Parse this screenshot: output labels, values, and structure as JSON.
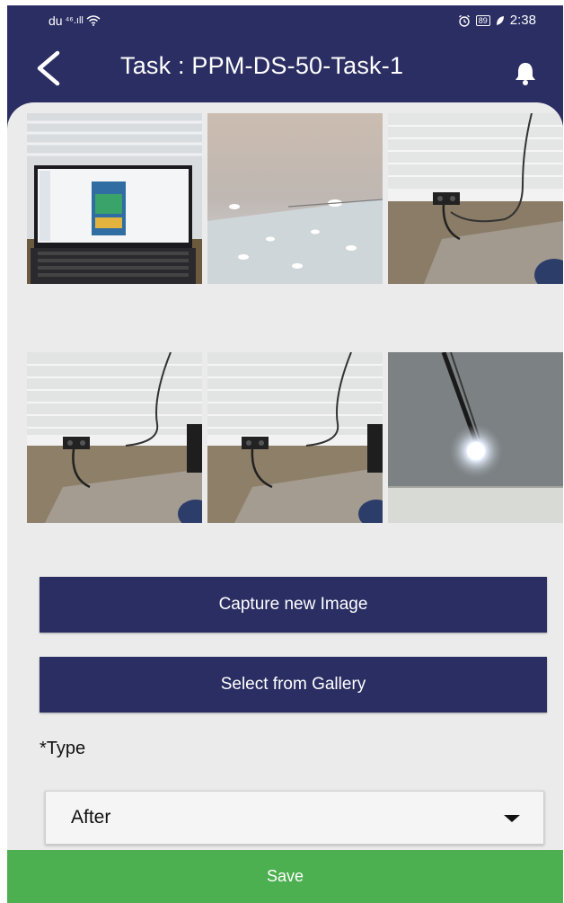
{
  "status_bar": {
    "carrier": "du",
    "signal": "⁴⁶.ıll",
    "battery": "89",
    "time": "2:38"
  },
  "header": {
    "title": "Task : PPM-DS-50-Task-1"
  },
  "photos": [
    {
      "subject": "laptop on desk"
    },
    {
      "subject": "ceiling lights"
    },
    {
      "subject": "wall socket with cables"
    },
    {
      "subject": "wall socket with cables"
    },
    {
      "subject": "wall socket with cables"
    },
    {
      "subject": "ceiling light fixture"
    }
  ],
  "actions": {
    "capture_label": "Capture new Image",
    "gallery_label": "Select from Gallery"
  },
  "form": {
    "type_label": "*Type",
    "type_value": "After"
  },
  "footer": {
    "save_label": "Save"
  },
  "colors": {
    "primary": "#2b2e63",
    "save": "#4caf50",
    "background": "#ebebeb"
  }
}
